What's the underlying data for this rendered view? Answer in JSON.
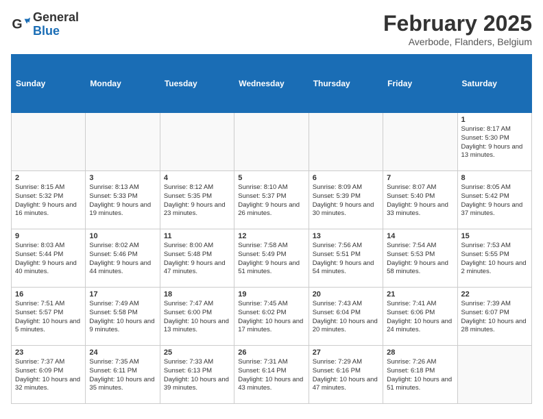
{
  "logo": {
    "general": "General",
    "blue": "Blue"
  },
  "header": {
    "title": "February 2025",
    "subtitle": "Averbode, Flanders, Belgium"
  },
  "weekdays": [
    "Sunday",
    "Monday",
    "Tuesday",
    "Wednesday",
    "Thursday",
    "Friday",
    "Saturday"
  ],
  "weeks": [
    [
      {
        "day": "",
        "info": ""
      },
      {
        "day": "",
        "info": ""
      },
      {
        "day": "",
        "info": ""
      },
      {
        "day": "",
        "info": ""
      },
      {
        "day": "",
        "info": ""
      },
      {
        "day": "",
        "info": ""
      },
      {
        "day": "1",
        "info": "Sunrise: 8:17 AM\nSunset: 5:30 PM\nDaylight: 9 hours and 13 minutes."
      }
    ],
    [
      {
        "day": "2",
        "info": "Sunrise: 8:15 AM\nSunset: 5:32 PM\nDaylight: 9 hours and 16 minutes."
      },
      {
        "day": "3",
        "info": "Sunrise: 8:13 AM\nSunset: 5:33 PM\nDaylight: 9 hours and 19 minutes."
      },
      {
        "day": "4",
        "info": "Sunrise: 8:12 AM\nSunset: 5:35 PM\nDaylight: 9 hours and 23 minutes."
      },
      {
        "day": "5",
        "info": "Sunrise: 8:10 AM\nSunset: 5:37 PM\nDaylight: 9 hours and 26 minutes."
      },
      {
        "day": "6",
        "info": "Sunrise: 8:09 AM\nSunset: 5:39 PM\nDaylight: 9 hours and 30 minutes."
      },
      {
        "day": "7",
        "info": "Sunrise: 8:07 AM\nSunset: 5:40 PM\nDaylight: 9 hours and 33 minutes."
      },
      {
        "day": "8",
        "info": "Sunrise: 8:05 AM\nSunset: 5:42 PM\nDaylight: 9 hours and 37 minutes."
      }
    ],
    [
      {
        "day": "9",
        "info": "Sunrise: 8:03 AM\nSunset: 5:44 PM\nDaylight: 9 hours and 40 minutes."
      },
      {
        "day": "10",
        "info": "Sunrise: 8:02 AM\nSunset: 5:46 PM\nDaylight: 9 hours and 44 minutes."
      },
      {
        "day": "11",
        "info": "Sunrise: 8:00 AM\nSunset: 5:48 PM\nDaylight: 9 hours and 47 minutes."
      },
      {
        "day": "12",
        "info": "Sunrise: 7:58 AM\nSunset: 5:49 PM\nDaylight: 9 hours and 51 minutes."
      },
      {
        "day": "13",
        "info": "Sunrise: 7:56 AM\nSunset: 5:51 PM\nDaylight: 9 hours and 54 minutes."
      },
      {
        "day": "14",
        "info": "Sunrise: 7:54 AM\nSunset: 5:53 PM\nDaylight: 9 hours and 58 minutes."
      },
      {
        "day": "15",
        "info": "Sunrise: 7:53 AM\nSunset: 5:55 PM\nDaylight: 10 hours and 2 minutes."
      }
    ],
    [
      {
        "day": "16",
        "info": "Sunrise: 7:51 AM\nSunset: 5:57 PM\nDaylight: 10 hours and 5 minutes."
      },
      {
        "day": "17",
        "info": "Sunrise: 7:49 AM\nSunset: 5:58 PM\nDaylight: 10 hours and 9 minutes."
      },
      {
        "day": "18",
        "info": "Sunrise: 7:47 AM\nSunset: 6:00 PM\nDaylight: 10 hours and 13 minutes."
      },
      {
        "day": "19",
        "info": "Sunrise: 7:45 AM\nSunset: 6:02 PM\nDaylight: 10 hours and 17 minutes."
      },
      {
        "day": "20",
        "info": "Sunrise: 7:43 AM\nSunset: 6:04 PM\nDaylight: 10 hours and 20 minutes."
      },
      {
        "day": "21",
        "info": "Sunrise: 7:41 AM\nSunset: 6:06 PM\nDaylight: 10 hours and 24 minutes."
      },
      {
        "day": "22",
        "info": "Sunrise: 7:39 AM\nSunset: 6:07 PM\nDaylight: 10 hours and 28 minutes."
      }
    ],
    [
      {
        "day": "23",
        "info": "Sunrise: 7:37 AM\nSunset: 6:09 PM\nDaylight: 10 hours and 32 minutes."
      },
      {
        "day": "24",
        "info": "Sunrise: 7:35 AM\nSunset: 6:11 PM\nDaylight: 10 hours and 35 minutes."
      },
      {
        "day": "25",
        "info": "Sunrise: 7:33 AM\nSunset: 6:13 PM\nDaylight: 10 hours and 39 minutes."
      },
      {
        "day": "26",
        "info": "Sunrise: 7:31 AM\nSunset: 6:14 PM\nDaylight: 10 hours and 43 minutes."
      },
      {
        "day": "27",
        "info": "Sunrise: 7:29 AM\nSunset: 6:16 PM\nDaylight: 10 hours and 47 minutes."
      },
      {
        "day": "28",
        "info": "Sunrise: 7:26 AM\nSunset: 6:18 PM\nDaylight: 10 hours and 51 minutes."
      },
      {
        "day": "",
        "info": ""
      }
    ]
  ]
}
